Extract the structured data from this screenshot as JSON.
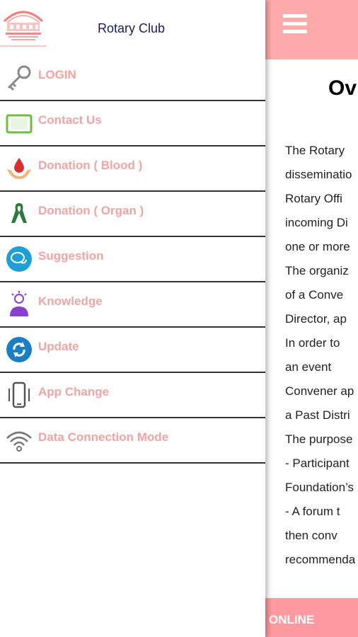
{
  "header": {
    "title": "Rotary Club"
  },
  "menu": [
    {
      "label": "LOGIN",
      "icon": "key-icon"
    },
    {
      "label": "Contact Us",
      "icon": "tablet-icon"
    },
    {
      "label": "Donation ( Blood )",
      "icon": "blood-drop-hands-icon"
    },
    {
      "label": "Donation ( Organ )",
      "icon": "ribbon-icon"
    },
    {
      "label": "Suggestion",
      "icon": "chat-bubbles-icon"
    },
    {
      "label": "Knowledge",
      "icon": "lightbulb-person-icon"
    },
    {
      "label": "Update",
      "icon": "refresh-icon"
    },
    {
      "label": "App Change",
      "icon": "phone-vibrate-icon"
    },
    {
      "label": "Data Connection Mode",
      "icon": "wifi-icon"
    }
  ],
  "content": {
    "title": "Ov",
    "lines": [
      "The  Rotary",
      "disseminatio",
      "Rotary   Offi",
      "incoming Di",
      "one or more",
      "The organiz",
      "of   a   Conve",
      "Director,  ap",
      "In  order  to",
      "an    event",
      "Convener ap",
      "a Past Distri",
      "The purpose",
      "- Participant",
      "Foundation’s",
      "- A  forum  t",
      "then     conv",
      "recommenda"
    ]
  },
  "footer": {
    "status": "ONLINE"
  },
  "colors": {
    "accent": "#ffaaaa",
    "label": "#f4a3a3",
    "title": "#1a1a6a"
  }
}
